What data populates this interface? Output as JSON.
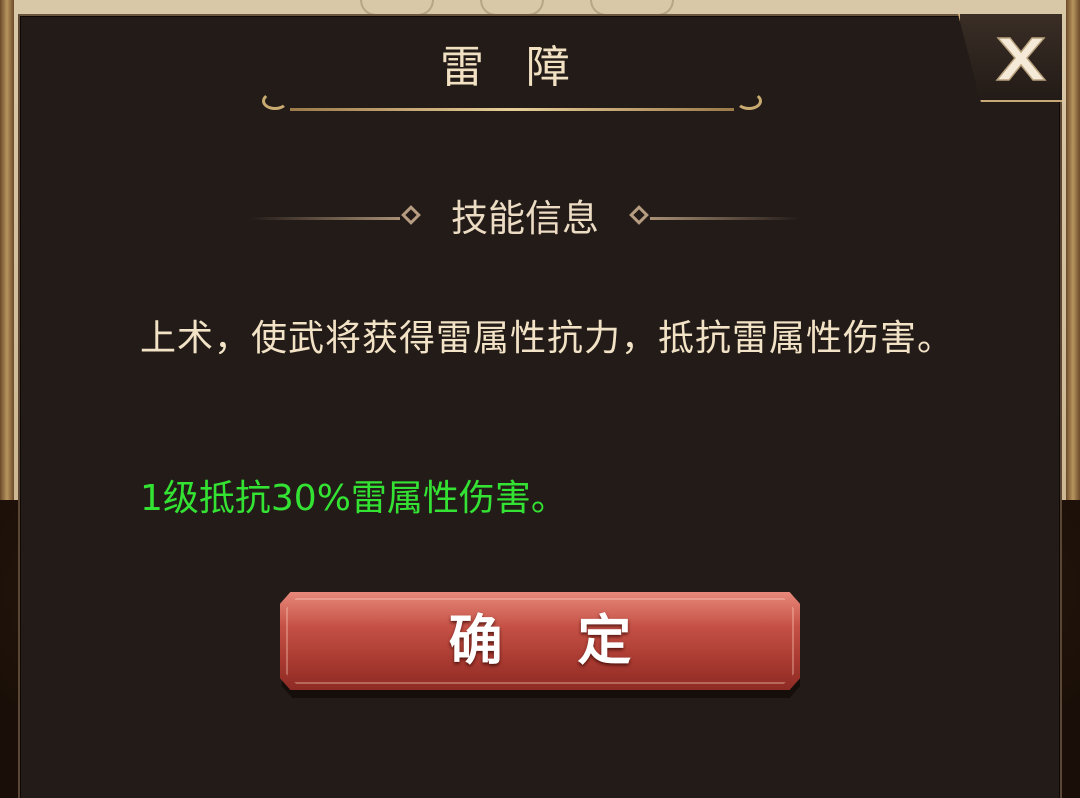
{
  "dialog": {
    "title": "雷 障",
    "section_title": "技能信息",
    "description": "上术，使武将获得雷属性抗力，抵抗雷属性伤害。",
    "effect": "1级抵抗30%雷属性伤害。",
    "confirm_label": "确 定",
    "close_icon": "close-x-icon"
  },
  "colors": {
    "panel_bg": "#231b18",
    "title_text": "#f1e1c2",
    "description_text": "#f3e3c6",
    "effect_text": "#33e233",
    "button_red": "#c55146"
  }
}
